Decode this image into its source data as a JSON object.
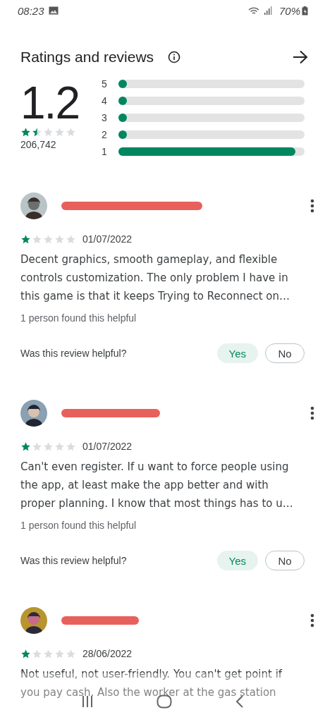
{
  "status_bar": {
    "time": "08:23",
    "battery": "70%"
  },
  "header": {
    "title": "Ratings and reviews"
  },
  "summary": {
    "score": "1.2",
    "stars": 1.5,
    "count": "206,742",
    "bars": [
      {
        "label": "5",
        "level": 0.0
      },
      {
        "label": "4",
        "level": 0.0
      },
      {
        "label": "3",
        "level": 0.0
      },
      {
        "label": "2",
        "level": 0.0
      },
      {
        "label": "1",
        "level": 0.95
      }
    ]
  },
  "reviews": [
    {
      "stars": 1,
      "date": "01/07/2022",
      "text": "Decent graphics, smooth gameplay, and flexible controls customization. The only problem I have in this game is that it keeps Trying to Reconnect on…",
      "helpful_count": "1 person found this helpful",
      "question": "Was this review helpful?",
      "votes": [
        {
          "label": "Yes",
          "selected": true
        },
        {
          "label": "No",
          "selected": false
        }
      ]
    },
    {
      "stars": 1,
      "date": "01/07/2022",
      "text": "Can't even register. If u want to force people using the app, at least make the app better and with proper planning. I know that most things has to u…",
      "helpful_count": "1 person found this helpful",
      "question": "Was this review helpful?",
      "votes": [
        {
          "label": "Yes",
          "selected": true
        },
        {
          "label": "No",
          "selected": false
        }
      ]
    },
    {
      "stars": 1,
      "date": "28/06/2022",
      "text": "Not useful, not user-friendly. You can't get point if you pay cash. Also the worker at the gas station"
    }
  ]
}
